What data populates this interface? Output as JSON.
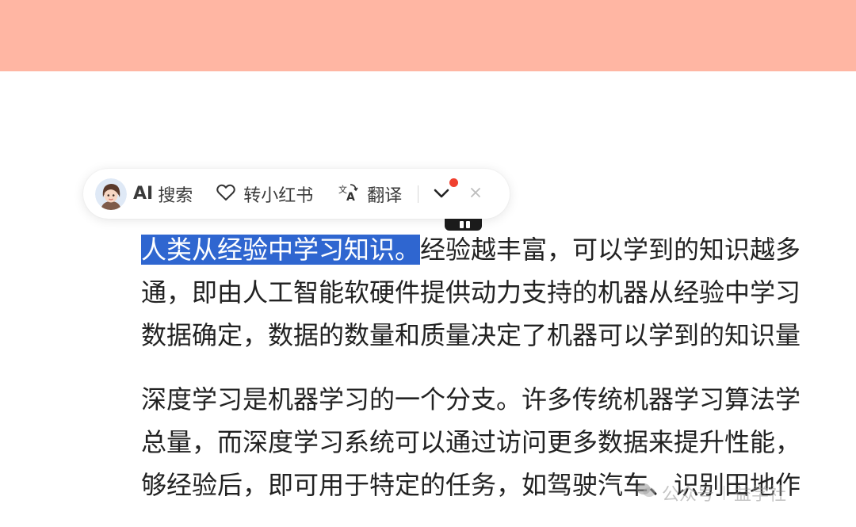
{
  "toolbar": {
    "ai_prefix": "AI",
    "ai_label": "搜索",
    "xhs_label": "转小红书",
    "translate_label": "翻译"
  },
  "article": {
    "para1_highlight": "人类从经验中学习知识。",
    "para1_line1_rest": "经验越丰富，可以学到的知识越多",
    "para1_line2": "通，即由人工智能软硬件提供动力支持的机器从经验中学习",
    "para1_line3": "数据确定，数据的数量和质量决定了机器可以学到的知识量",
    "para2_line1": "深度学习是机器学习的一个分支。许多传统机器学习算法学",
    "para2_line2": "总量，而深度学习系统可以通过访问更多数据来提升性能，",
    "para2_line3": "够经验后，即可用于特定的任务，如驾驶汽车、识别田地作"
  },
  "watermark": {
    "left": "公众号",
    "right": "益学社"
  },
  "colors": {
    "top_band": "#ffb6a3",
    "selection": "#2f66d0",
    "badge": "#f0402f"
  },
  "icons": [
    "avatar-icon",
    "heart-icon",
    "translate-icon",
    "chevron-down-icon",
    "close-icon",
    "wechat-icon"
  ]
}
